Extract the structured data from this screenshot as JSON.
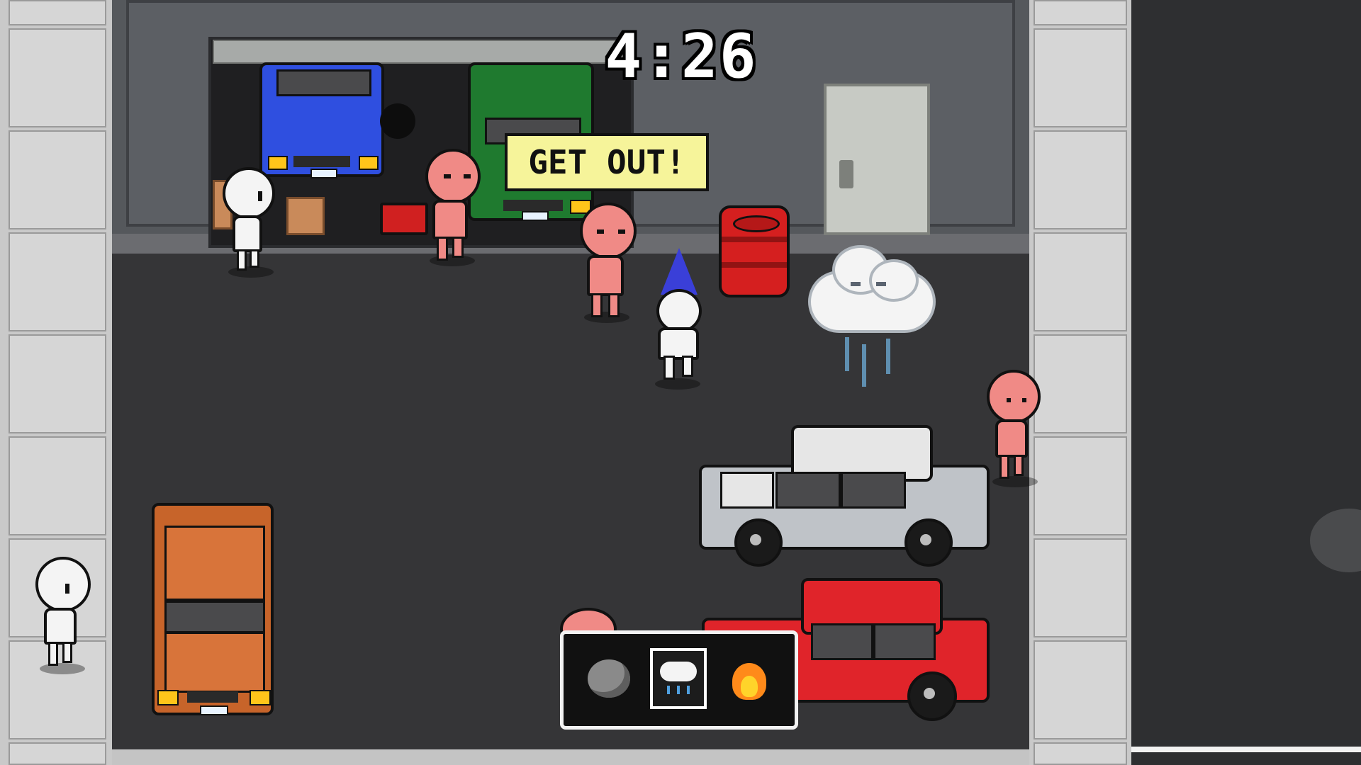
{
  "hud": {
    "timer": "4:26"
  },
  "speech_bubble": {
    "text": "GET OUT!"
  },
  "hotbar": {
    "slots": [
      {
        "name": "rock",
        "icon": "rock-icon",
        "selected": false
      },
      {
        "name": "rain-cloud",
        "icon": "rain-cloud-icon",
        "selected": true
      },
      {
        "name": "fire",
        "icon": "fire-icon",
        "selected": false
      }
    ]
  },
  "colors": {
    "road": "#353537",
    "sidewalk": "#c9c9c9",
    "speech_bg": "#f6f49a",
    "npc_pink": "#f08a86",
    "npc_white": "#f4f4f4",
    "car_blue": "#2f4fe0",
    "car_green": "#1f7a2f",
    "car_orange": "#c7642a",
    "car_red": "#e0242a",
    "car_white": "#e6e6e6",
    "barrel_red": "#d51f1f"
  }
}
